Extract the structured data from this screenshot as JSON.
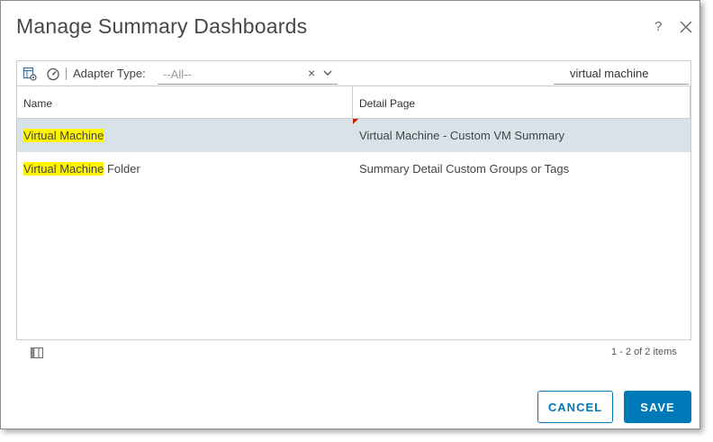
{
  "dialog": {
    "title": "Manage Summary Dashboards",
    "help_label": "?"
  },
  "toolbar": {
    "adapter_type_label": "Adapter Type:",
    "adapter_type_value": "--All--",
    "clear_label": "×",
    "search_value": "virtual machine",
    "icons": [
      "dashboard-settings-icon",
      "speedometer-icon",
      "close-icon",
      "chevron-down-icon"
    ]
  },
  "table": {
    "columns": [
      "Name",
      "Detail Page"
    ],
    "rows": [
      {
        "name_match": "Virtual Machine",
        "name_rest": "",
        "detail": "Virtual Machine - Custom VM Summary",
        "selected": true
      },
      {
        "name_match": "Virtual Machine",
        "name_rest": " Folder",
        "detail": "Summary Detail Custom Groups or Tags",
        "selected": false
      }
    ]
  },
  "footer": {
    "count_text": "1 - 2 of 2 items"
  },
  "buttons": {
    "cancel": "CANCEL",
    "save": "SAVE"
  },
  "colors": {
    "accent": "#0079b8",
    "selected_row": "#d8e3e9",
    "highlight": "#fff500"
  }
}
